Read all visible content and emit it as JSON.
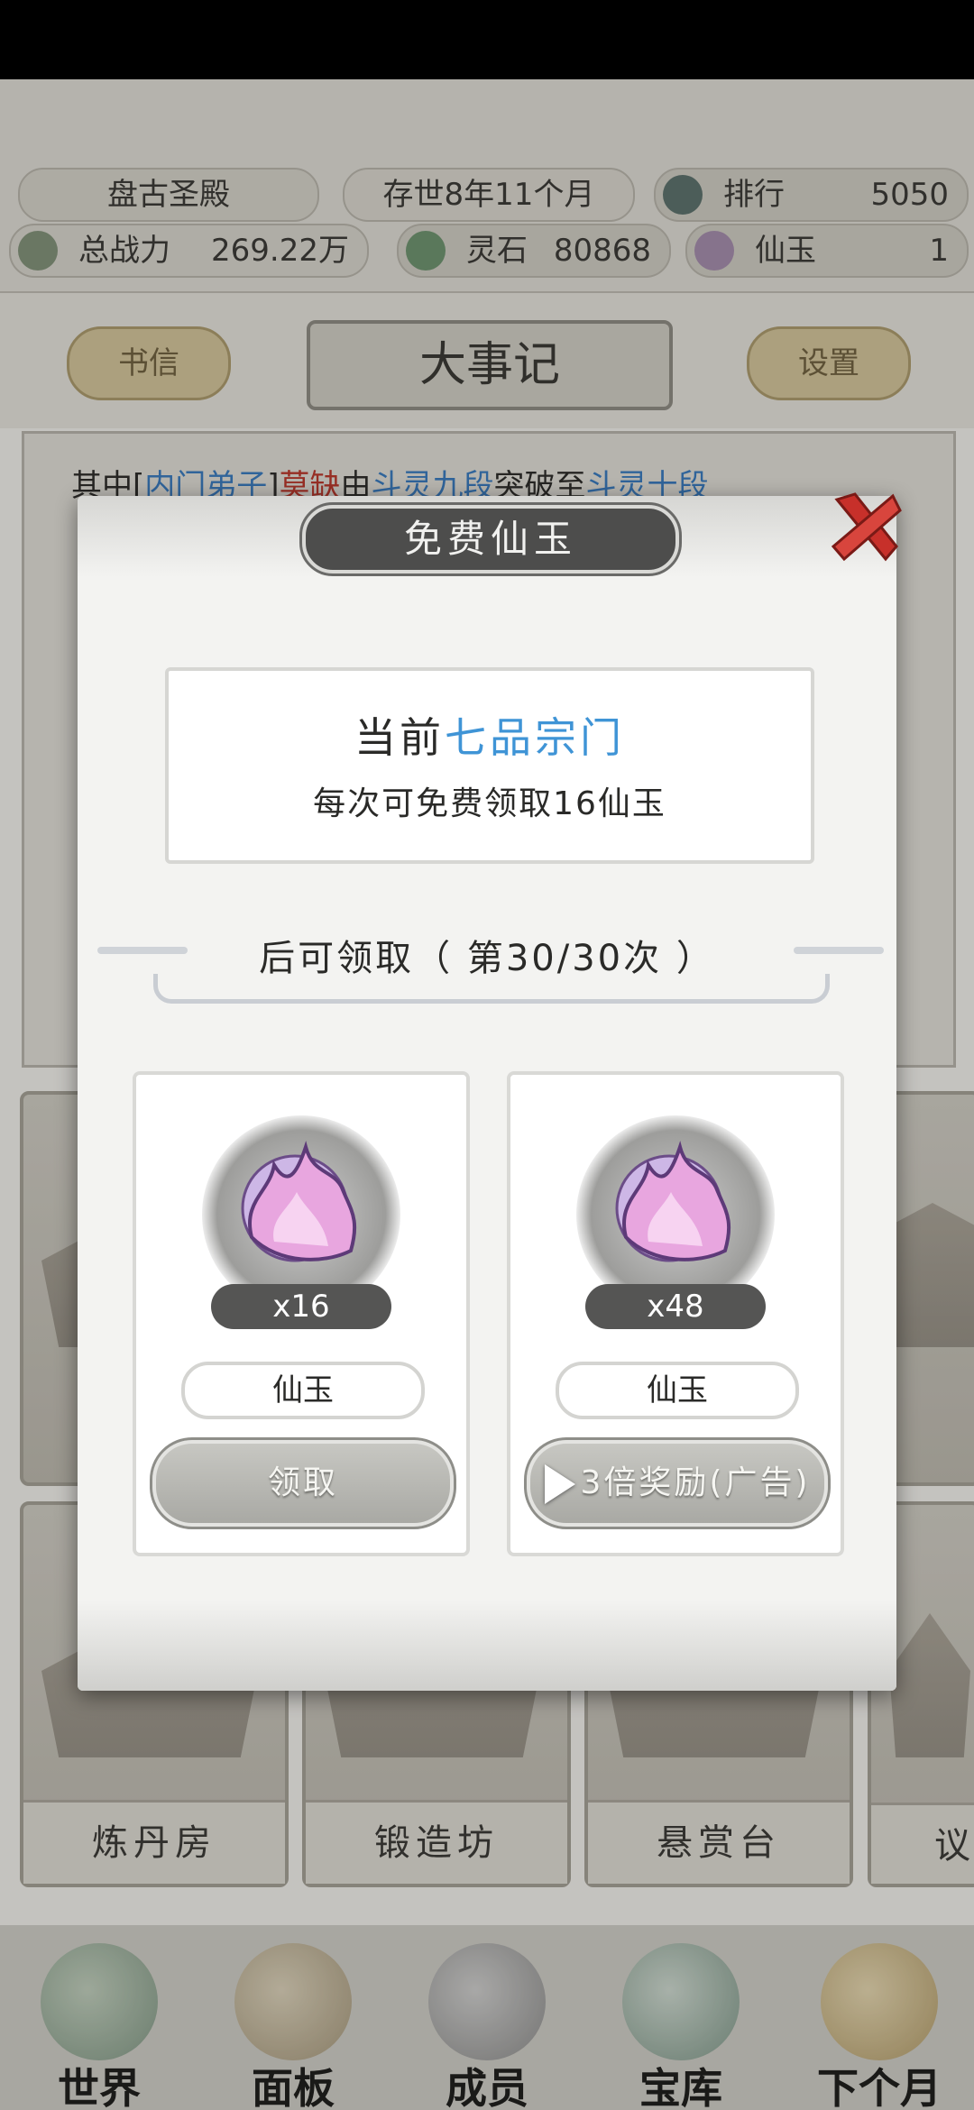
{
  "top": {
    "realm_name": "盘古圣殿",
    "time_in_world": "存世8年11个月",
    "rank_label": "排行",
    "rank_value": "5050",
    "power_label": "总战力",
    "power_value": "269.22万",
    "spirit_stone_label": "灵石",
    "spirit_stone_value": "80868",
    "jade_label": "仙玉",
    "jade_value": "1"
  },
  "header": {
    "left_button": "书信",
    "title": "大事记",
    "right_button": "设置"
  },
  "log": {
    "line1_prefix": "其中[",
    "line1_role": "内门弟子",
    "line1_mid": "]",
    "line1_name": "莫缺",
    "line1_text": "由",
    "line1_from": "斗灵九段",
    "line1_text2": "突破至",
    "line1_to": "斗灵十段"
  },
  "buildings": [
    {
      "name": "炼丹房"
    },
    {
      "name": "锻造坊"
    },
    {
      "name": "悬赏台"
    },
    {
      "name": "议"
    }
  ],
  "bottom_nav": [
    {
      "label": "世界",
      "icon": "world-icon"
    },
    {
      "label": "面板",
      "icon": "panel-icon"
    },
    {
      "label": "成员",
      "icon": "members-icon"
    },
    {
      "label": "宝库",
      "icon": "treasury-icon"
    },
    {
      "label": "下个月",
      "icon": "next-month-icon"
    }
  ],
  "modal": {
    "title": "免费仙玉",
    "info_prefix": "当前",
    "info_sect": "七品宗门",
    "info_line2": "每次可免费领取16仙玉",
    "timer_text": "后可领取（ 第30/30次 ）",
    "cards": [
      {
        "qty": "x16",
        "item": "仙玉",
        "action": "领取"
      },
      {
        "qty": "x48",
        "item": "仙玉",
        "action": "3倍奖励(广告)"
      }
    ],
    "colors": {
      "highlight": "#3f94d6",
      "close_red": "#c7302a"
    }
  }
}
